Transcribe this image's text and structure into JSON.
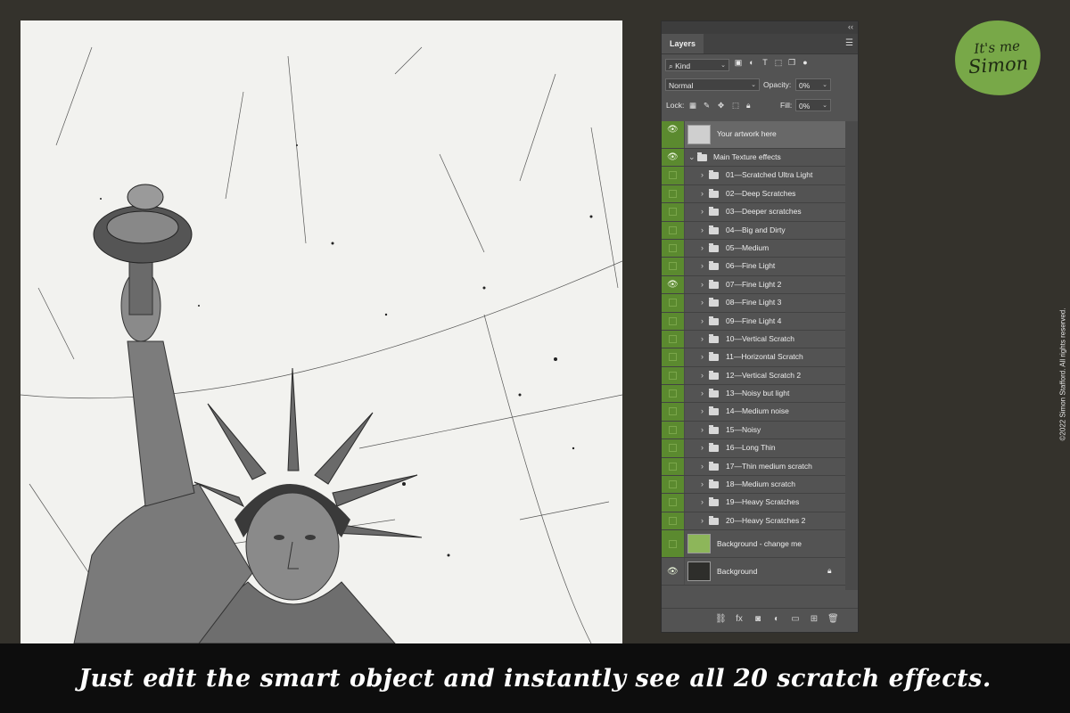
{
  "canvas": {
    "description_name": "statue-of-liberty-artwork"
  },
  "panel": {
    "tab_label": "Layers",
    "filter_kind": "Kind",
    "blend_mode": "Normal",
    "opacity_label": "Opacity:",
    "opacity_value": "0%",
    "lock_label": "Lock:",
    "fill_label": "Fill:",
    "fill_value": "0%",
    "layers": [
      {
        "label": "Your artwork here"
      },
      {
        "label": "Main Texture effects"
      },
      {
        "label": "01—Scratched Ultra Light"
      },
      {
        "label": "02—Deep Scratches"
      },
      {
        "label": "03—Deeper scratches"
      },
      {
        "label": "04—Big and Dirty"
      },
      {
        "label": "05—Medium"
      },
      {
        "label": "06—Fine Light"
      },
      {
        "label": "07—Fine Light 2"
      },
      {
        "label": "08—Fine Light 3"
      },
      {
        "label": "09—Fine Light 4"
      },
      {
        "label": "10—Vertical Scratch"
      },
      {
        "label": "11—Horizontal Scratch"
      },
      {
        "label": "12—Vertical Scratch 2"
      },
      {
        "label": "13—Noisy but light"
      },
      {
        "label": "14—Medium noise"
      },
      {
        "label": "15—Noisy"
      },
      {
        "label": "16—Long Thin"
      },
      {
        "label": "17—Thin medium scratch"
      },
      {
        "label": "18—Medium scratch"
      },
      {
        "label": "19—Heavy Scratches"
      },
      {
        "label": "20—Heavy Scratches 2"
      },
      {
        "label": "Background - change me"
      },
      {
        "label": "Background"
      }
    ],
    "colors": {
      "visibility_column": "#5b8a2f",
      "panel_bg": "#535353"
    }
  },
  "badge": {
    "line1": "It's me",
    "line2": "Simon",
    "color": "#78a848"
  },
  "copyright": "©2022 Simon Stafford. All rights reserved.",
  "banner": {
    "text": "Just edit the smart object and instantly see all 20 scratch effects."
  }
}
